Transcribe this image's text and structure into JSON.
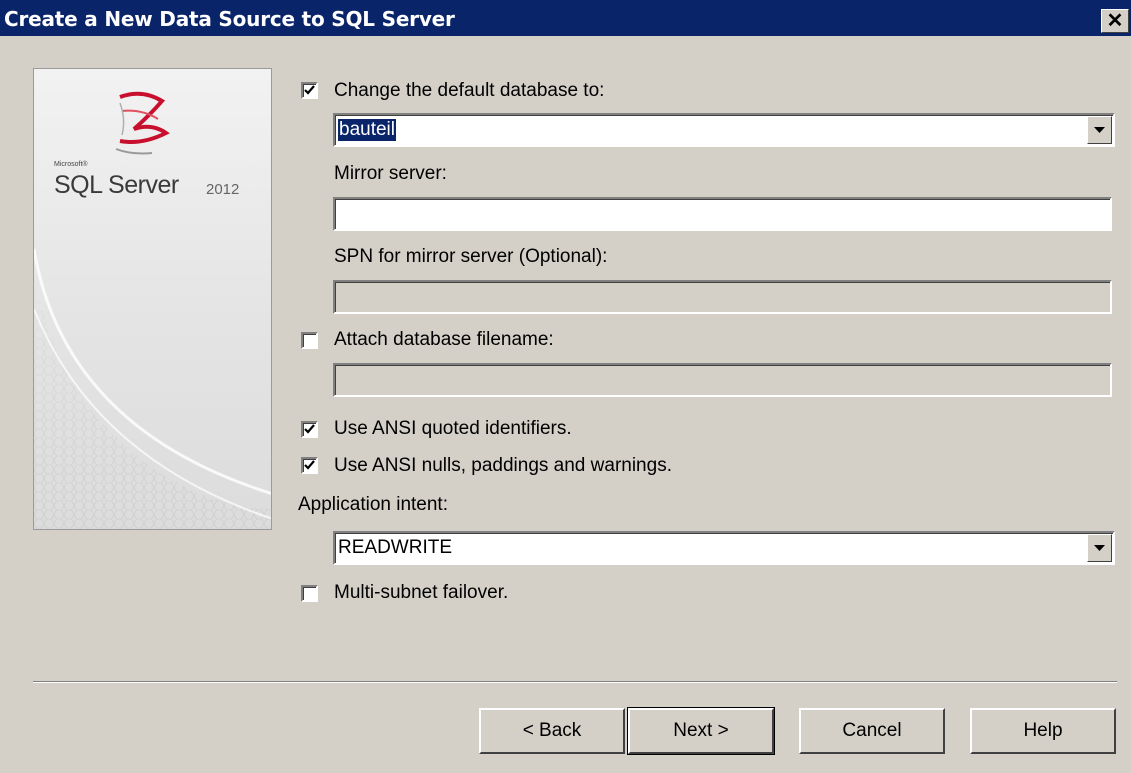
{
  "window": {
    "title": "Create a New Data Source to SQL Server",
    "close_glyph": "✕"
  },
  "banner": {
    "brand_small": "Microsoft®",
    "product": "SQL Server",
    "year": "2012",
    "logo_icon": "sql-server-logo-icon"
  },
  "options": {
    "change_default_db": {
      "label": "Change the default database to:",
      "checked": true
    },
    "database_combo": {
      "value": "bauteil"
    },
    "mirror_server": {
      "label": "Mirror server:",
      "value": ""
    },
    "spn_mirror": {
      "label": "SPN for mirror server (Optional):",
      "value": ""
    },
    "attach_db": {
      "label": "Attach database filename:",
      "checked": false
    },
    "attach_db_field": {
      "value": ""
    },
    "ansi_quoted": {
      "label": "Use ANSI quoted identifiers.",
      "checked": true
    },
    "ansi_nulls": {
      "label": "Use ANSI nulls, paddings and warnings.",
      "checked": true
    },
    "app_intent": {
      "label": "Application intent:",
      "value": "READWRITE"
    },
    "multi_subnet": {
      "label": "Multi-subnet failover.",
      "checked": false
    }
  },
  "buttons": {
    "back": "< Back",
    "next": "Next >",
    "cancel": "Cancel",
    "help": "Help"
  },
  "colors": {
    "titlebar": "#0a246a",
    "dialog_bg": "#d4d0c8",
    "selection": "#0a246a",
    "logo_red": "#c8102e"
  }
}
